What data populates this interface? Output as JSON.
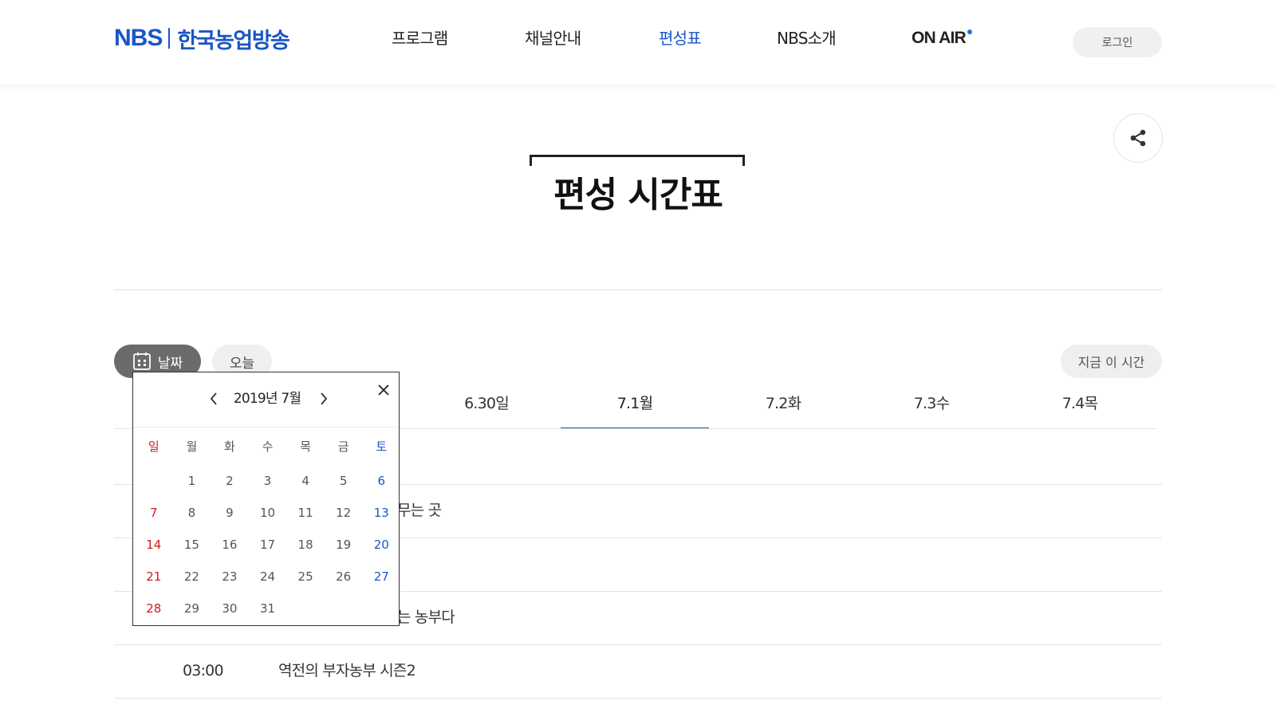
{
  "header": {
    "logo_en": "NBS",
    "logo_kr": "한국농업방송",
    "nav": [
      "프로그램",
      "채널안내",
      "편성표",
      "NBS소개"
    ],
    "active_nav": "편성표",
    "onair": "ON AIR",
    "login": "로그인",
    "brand_color": "#1a56c4"
  },
  "page": {
    "title": "편성 시간표"
  },
  "controls": {
    "date_label": "날짜",
    "today_label": "오늘",
    "now_label": "지금 이 시간"
  },
  "day_tabs": [
    "6.30일",
    "7.1월",
    "7.2화",
    "7.3수",
    "7.4목"
  ],
  "active_tab": "7.1월",
  "schedule": [
    {
      "time": "",
      "title": ""
    },
    {
      "time": "",
      "title": "무는 곳"
    },
    {
      "time": "",
      "title": ""
    },
    {
      "time": "",
      "title": "는 농부다"
    },
    {
      "time": "03:00",
      "title": "역전의 부자농부 시즌2"
    }
  ],
  "calendar": {
    "month_label": "2019년 7월",
    "weekdays": [
      "일",
      "월",
      "화",
      "수",
      "목",
      "금",
      "토"
    ],
    "weeks": [
      [
        "",
        "1",
        "2",
        "3",
        "4",
        "5",
        "6"
      ],
      [
        "7",
        "8",
        "9",
        "10",
        "11",
        "12",
        "13"
      ],
      [
        "14",
        "15",
        "16",
        "17",
        "18",
        "19",
        "20"
      ],
      [
        "21",
        "22",
        "23",
        "24",
        "25",
        "26",
        "27"
      ],
      [
        "28",
        "29",
        "30",
        "31",
        "",
        "",
        ""
      ]
    ],
    "sunday_color": "#d01b1b",
    "saturday_color": "#1a56c4"
  }
}
